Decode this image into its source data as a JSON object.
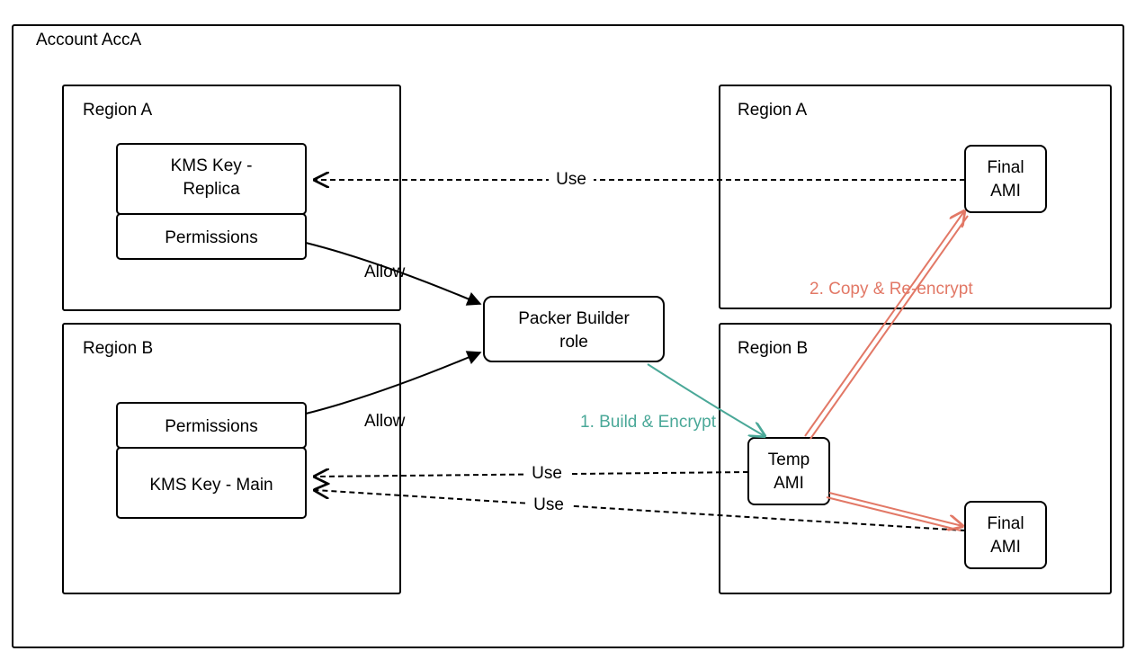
{
  "account_title": "Account AccA",
  "left_region_a": {
    "title": "Region A",
    "kms_key": "KMS Key - Replica",
    "permissions": "Permissions"
  },
  "left_region_b": {
    "title": "Region B",
    "kms_key": "KMS Key - Main",
    "permissions": "Permissions"
  },
  "packer_role": "Packer Builder role",
  "right_region_a": {
    "title": "Region A",
    "final_ami": "Final AMI"
  },
  "right_region_b": {
    "title": "Region B",
    "temp_ami": "Temp AMI",
    "final_ami": "Final AMI"
  },
  "edges": {
    "allow_top": "Allow",
    "allow_bottom": "Allow",
    "use_top": "Use",
    "use_mid": "Use",
    "use_bottom": "Use",
    "build_encrypt": "1. Build & Encrypt",
    "copy_reencrypt": "2. Copy & Re-encrypt"
  },
  "colors": {
    "teal": "#4aa898",
    "coral": "#e27866"
  }
}
